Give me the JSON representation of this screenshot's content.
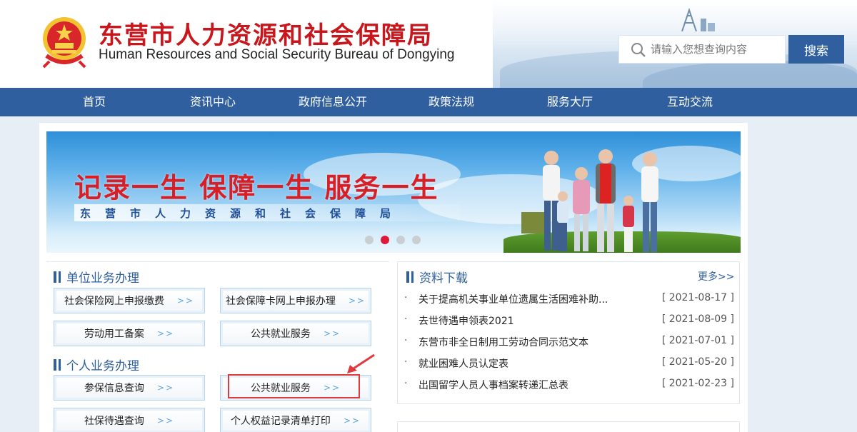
{
  "header": {
    "title_cn": "东营市人力资源和社会保障局",
    "title_en": "Human Resources and Social Security Bureau of Dongying",
    "search_placeholder": "请输入您想查询内容",
    "search_button": "搜索"
  },
  "nav": {
    "items": [
      "首页",
      "资讯中心",
      "政府信息公开",
      "政策法规",
      "服务大厅",
      "互动交流"
    ]
  },
  "banner": {
    "slogan": "记录一生 保障一生 服务一生",
    "subtitle": "东营市人力资源和社会保障局",
    "active_slide": 2,
    "slide_count": 4
  },
  "unit_services": {
    "heading": "单位业务办理",
    "items": [
      "社会保险网上申报缴费",
      "社会保障卡网上申报办理",
      "劳动用工备案",
      "公共就业服务"
    ]
  },
  "personal_services": {
    "heading": "个人业务办理",
    "items": [
      "参保信息查询",
      "公共就业服务",
      "社保待遇查询",
      "个人权益记录清单打印"
    ]
  },
  "arrow_text": ">>",
  "downloads": {
    "heading": "资料下载",
    "more": "更多>>",
    "items": [
      {
        "title": "关于提高机关事业单位遗属生活困难补助...",
        "date": "[ 2021-08-17 ]"
      },
      {
        "title": "去世待遇申领表2021",
        "date": "[ 2021-08-09 ]"
      },
      {
        "title": "东营市非全日制用工劳动合同示范文本",
        "date": "[ 2021-07-01 ]"
      },
      {
        "title": "就业困难人员认定表",
        "date": "[ 2021-05-20 ]"
      },
      {
        "title": "出国留学人员人事档案转递汇总表",
        "date": "[ 2021-02-23 ]"
      }
    ]
  },
  "colors": {
    "brand_red": "#c8161d",
    "nav_blue": "#2f5f9f",
    "highlight_red": "#e0393e"
  }
}
